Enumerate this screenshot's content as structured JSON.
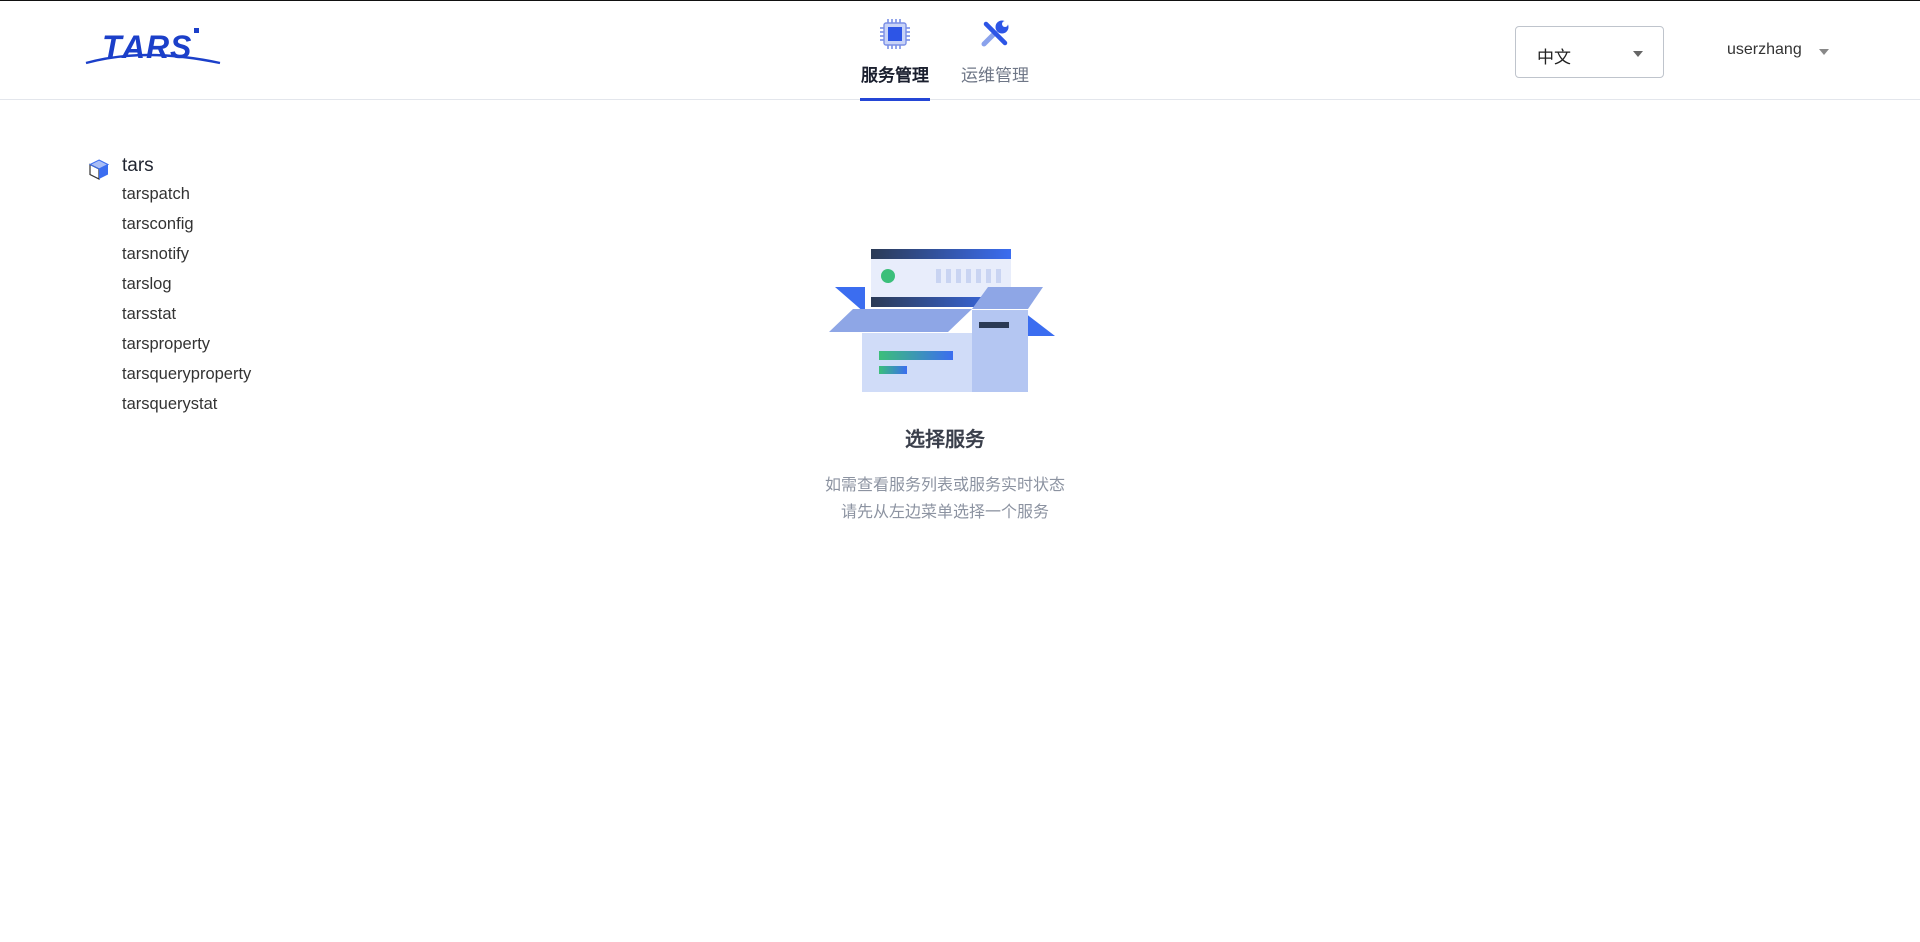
{
  "app": {
    "logo_text": "TARS"
  },
  "nav": {
    "tabs": [
      {
        "label": "服务管理",
        "icon": "chip-icon",
        "active": true
      },
      {
        "label": "运维管理",
        "icon": "tools-icon",
        "active": false
      }
    ]
  },
  "language": {
    "selected": "中文"
  },
  "user": {
    "name": "userzhang"
  },
  "tree": {
    "root": "tars",
    "items": [
      "tarspatch",
      "tarsconfig",
      "tarsnotify",
      "tarslog",
      "tarsstat",
      "tarsproperty",
      "tarsqueryproperty",
      "tarsquerystat"
    ]
  },
  "empty_state": {
    "title": "选择服务",
    "line1": "如需查看服务列表或服务实时状态",
    "line2": "请先从左边菜单选择一个服务"
  },
  "colors": {
    "accent": "#2446d6",
    "brand": "#1b3fc9",
    "tree_cube": "#3b6df0",
    "status_green": "#3bbf7a"
  }
}
